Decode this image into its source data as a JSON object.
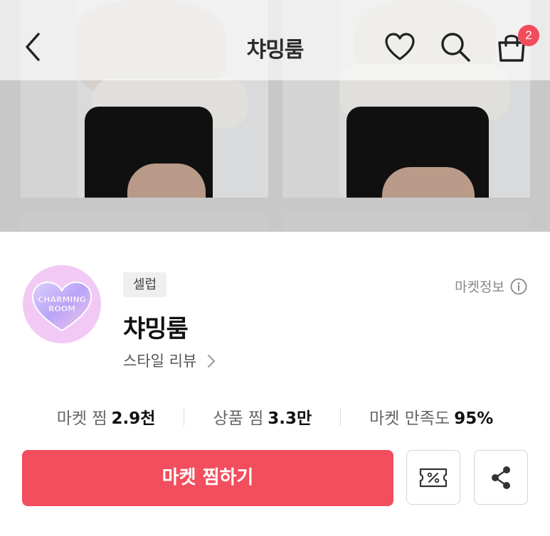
{
  "header": {
    "title": "챠밍룸",
    "cart_count": "2",
    "icons": [
      "back-icon",
      "heart-icon",
      "search-icon",
      "shopping-bag-icon"
    ]
  },
  "market": {
    "tag": "셀럽",
    "name": "챠밍룸",
    "style_review": "스타일 리뷰",
    "info_label": "마켓정보",
    "logo_text_line1": "CHARMING",
    "logo_text_line2": "ROOM"
  },
  "stats": [
    {
      "label": "마켓 찜",
      "value": "2.9천"
    },
    {
      "label": "상품 찜",
      "value": "3.3만"
    },
    {
      "label": "마켓 만족도",
      "value": "95%"
    }
  ],
  "actions": {
    "primary_label": "마켓 찜하기",
    "coupon_icon": "coupon-icon",
    "share_icon": "share-icon"
  },
  "colors": {
    "accent": "#f24e5d",
    "badge": "#f24b5a",
    "logo_bg": "#f2c9f4"
  }
}
